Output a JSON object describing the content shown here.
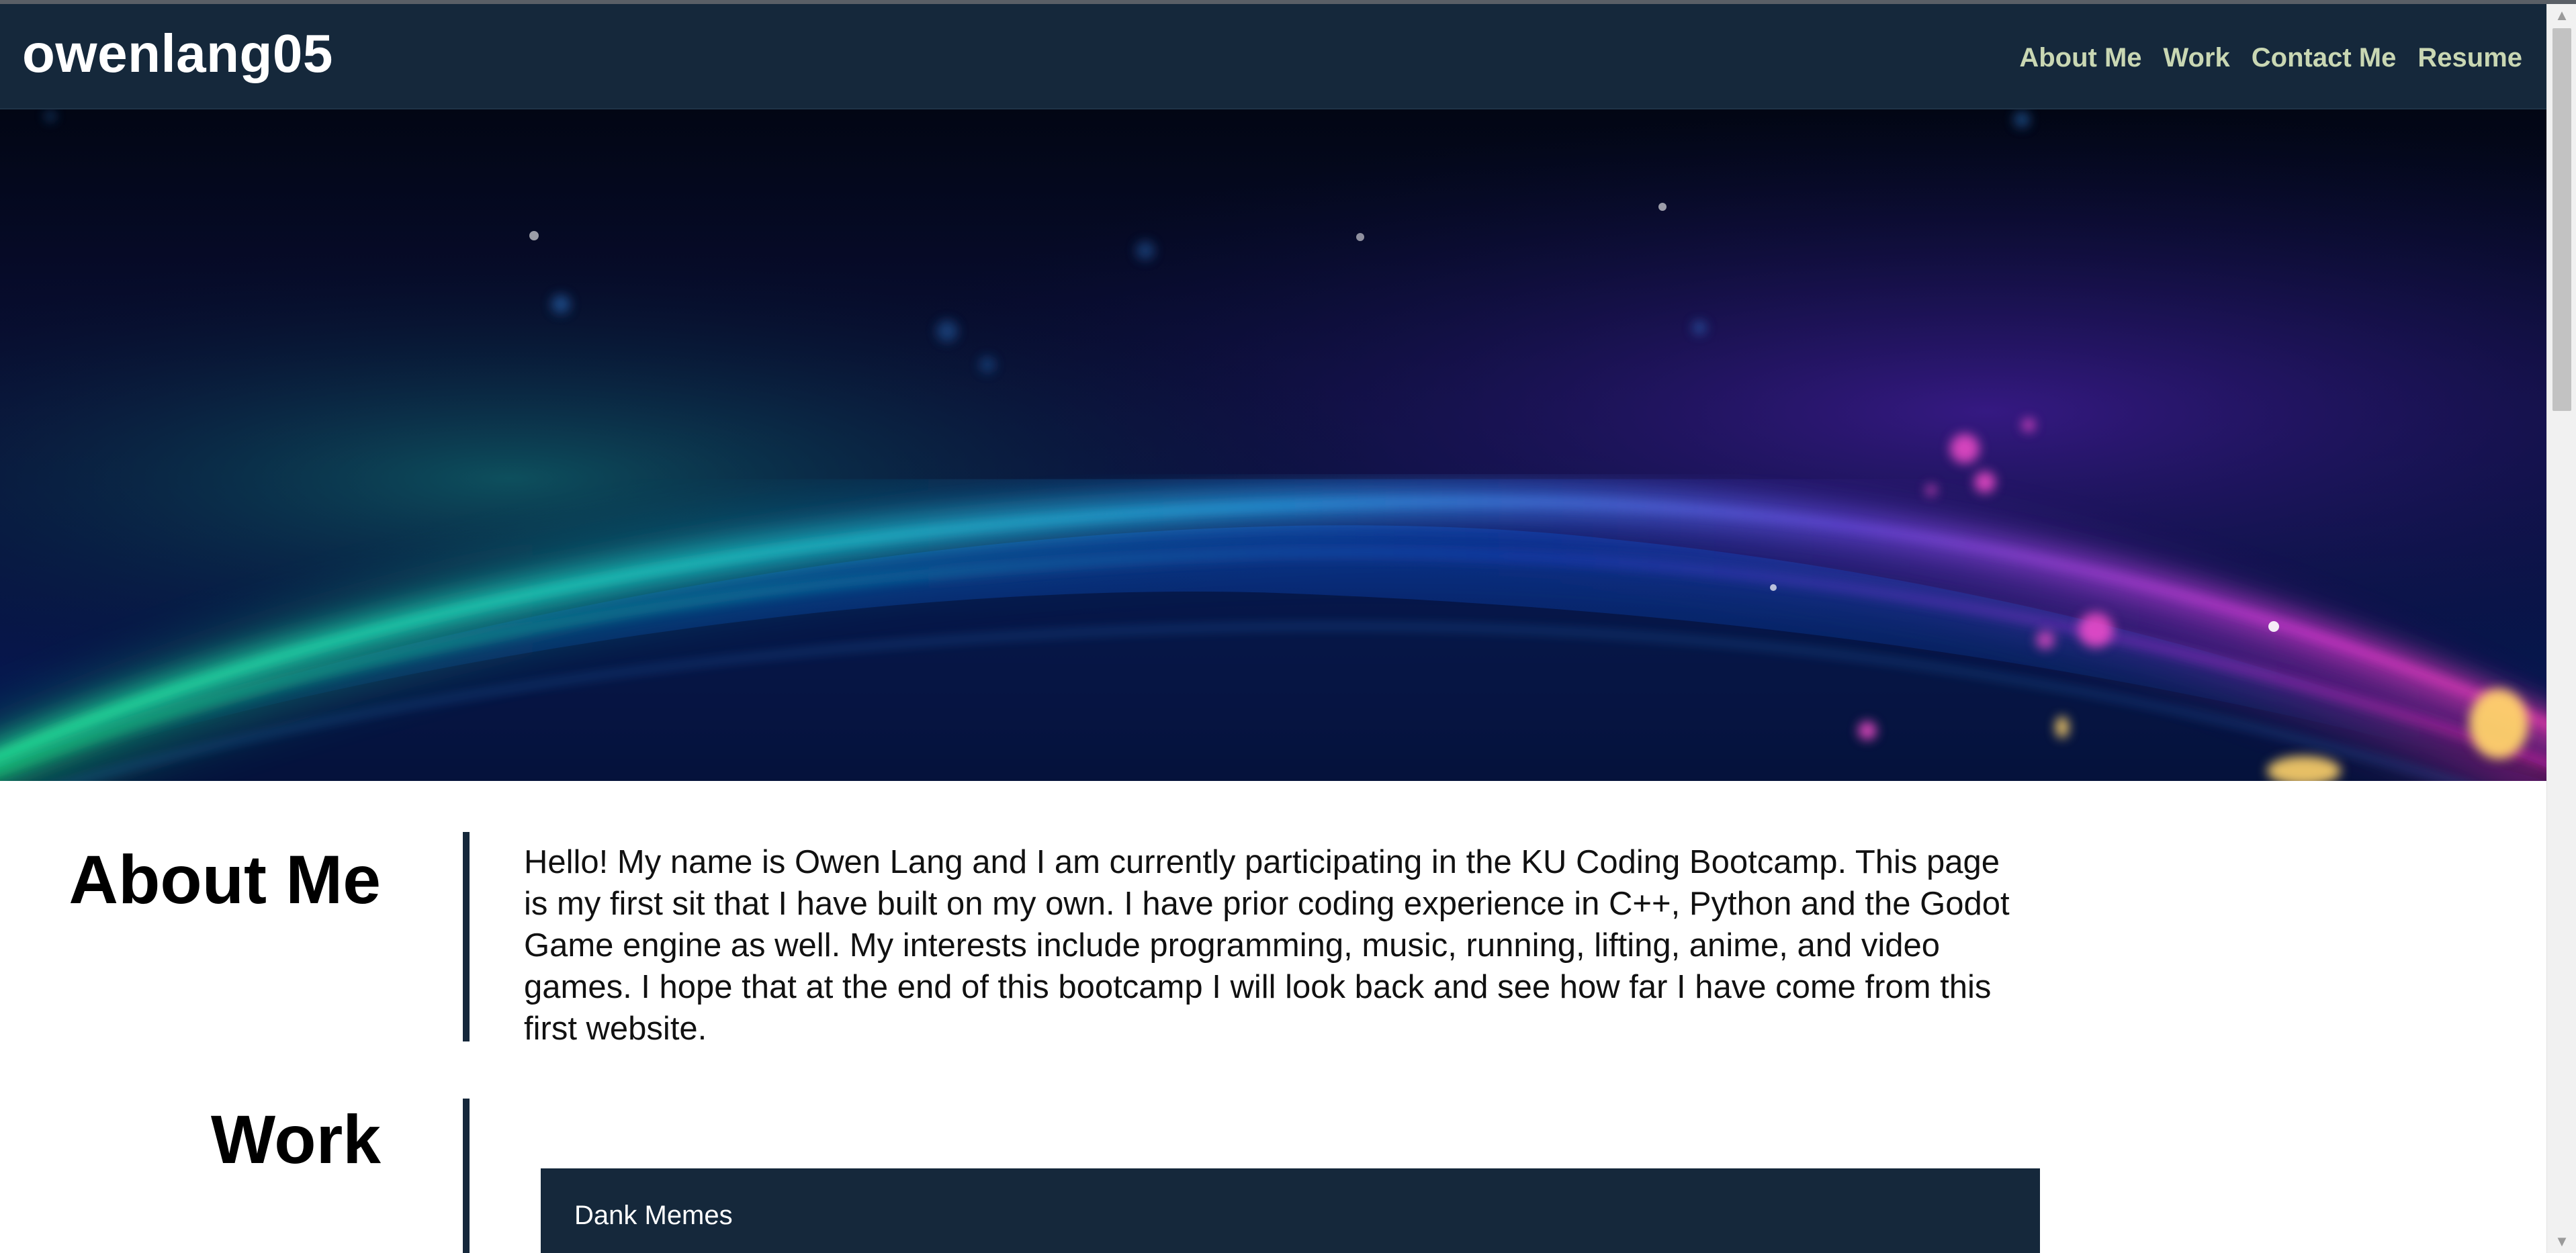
{
  "site": {
    "brand": "owenlang05"
  },
  "nav": {
    "items": [
      "About Me",
      "Work",
      "Contact Me",
      "Resume"
    ]
  },
  "hero": {
    "description": "abstract neon light arcs banner"
  },
  "about": {
    "title": "About Me",
    "text": "Hello! My name is Owen Lang and I am currently participating in the KU Coding Bootcamp. This page is my first sit that I have built on my own. I have prior coding experience in C++, Python and the Godot Game engine as well. My interests include programming, music, running, lifting, anime, and video games. I hope that at the end of this bootcamp I will look back and see how far I have come from this first website."
  },
  "work": {
    "title": "Work",
    "cards": [
      {
        "title": "Dank Memes"
      }
    ]
  },
  "colors": {
    "navbar": "#15283b",
    "nav_link": "#c9d7b3",
    "brand_text": "#ffffff",
    "rule": "#15283b",
    "card_bg": "#15283b"
  }
}
